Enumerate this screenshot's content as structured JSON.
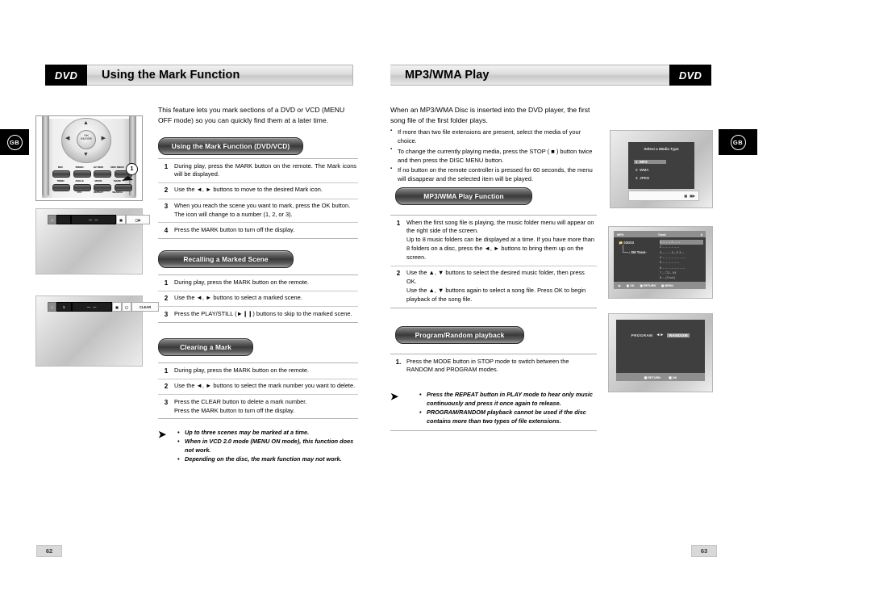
{
  "tabs": {
    "left_label": "GB",
    "right_label": "GB"
  },
  "left_page": {
    "badge": "DVD",
    "title": "Using the Mark Function",
    "intro": "This feature lets you mark sections of a DVD or VCD (MENU OFF mode) so you can quickly find them at a later time.",
    "page_number": "62",
    "sections": [
      {
        "heading": "Using the Mark Function (DVD/VCD)",
        "steps": [
          {
            "num": "1",
            "text": "During play, press the MARK button on the remote. The Mark icons will be displayed."
          },
          {
            "num": "2",
            "text": "Use the ◄, ► buttons to move to the desired Mark icon."
          },
          {
            "num": "3",
            "text": "When you reach the scene you want to mark, press the OK button. The icon will change to a number (1, 2, or 3)."
          },
          {
            "num": "4",
            "text": "Press the MARK button to turn off the display."
          }
        ]
      },
      {
        "heading": "Recalling a Marked Scene",
        "steps": [
          {
            "num": "1",
            "text": "During play, press the MARK button on the remote."
          },
          {
            "num": "2",
            "text": "Use the ◄, ► buttons to select a marked scene."
          },
          {
            "num": "3",
            "text": "Press the PLAY/STILL (►❙❙) buttons to skip to the marked scene."
          }
        ]
      },
      {
        "heading": "Clearing a Mark",
        "steps": [
          {
            "num": "1",
            "text": "During play, press the MARK button on the remote."
          },
          {
            "num": "2",
            "text": "Use the ◄, ► buttons to select the mark number you want to delete."
          },
          {
            "num": "3",
            "text": "Press the CLEAR button to delete a mark number.\nPress the MARK button to turn off the display."
          }
        ]
      }
    ],
    "notes": [
      "Up to three scenes may be marked at a time.",
      "When in VCD 2.0 mode (MENU ON mode), this function does not work.",
      "Depending on the disc, the mark function may not work."
    ],
    "remote": {
      "callout_number": "1",
      "center_label": "OK\nENTER",
      "buttons_row1": [
        "REC",
        "SPEED",
        "EZ VIEW",
        "DISC MENU"
      ],
      "buttons_row2": [
        "TIMER",
        "ANGLE",
        "MODE",
        "MARK"
      ],
      "buttons_row3_labels": [
        "",
        "VFC",
        "REPEAT",
        "SEARCH"
      ]
    },
    "osd_shots": [
      {
        "segments": [
          "①",
          "‒‒",
          "‒‒",
          "⬜⬜",
          "⏹"
        ],
        "mark_value": ""
      },
      {
        "segments": [
          "①",
          "1",
          "‒‒",
          "⬜",
          "CLEAR"
        ],
        "mark_value": "1",
        "clear_label": "CLEAR"
      }
    ]
  },
  "right_page": {
    "badge": "DVD",
    "title": "MP3/WMA Play",
    "intro": "When an MP3/WMA Disc is inserted into the DVD player, the first song file of the first folder plays.",
    "page_number": "63",
    "bullets": [
      "If more than two file extensions are present, select the media of your choice.",
      "To change the currently playing media, press the STOP ( ■ ) button twice and then press the DISC MENU button.",
      "If no button on the remote controller is pressed for 60 seconds, the menu will disappear and the selected item will be played."
    ],
    "sections": [
      {
        "heading": "MP3/WMA Play Function",
        "steps": [
          {
            "num": "1",
            "text": "When the first song file is playing, the music folder menu will appear on the right side of the screen.\nUp to 8 music folders can be displayed at a time. If you have more than 8 folders on a disc, press the ◄, ► buttons to bring them up on the screen."
          },
          {
            "num": "2",
            "text": "Use the ▲, ▼ buttons to select the desired music folder, then press OK.\nUse the ▲, ▼ buttons again to select a song file. Press OK to begin playback of the song file."
          }
        ]
      },
      {
        "heading": "Program/Random playback",
        "steps": [
          {
            "num": "1.",
            "text": "Press the MODE button in STOP mode to switch between the RANDOM and PROGRAM modes."
          }
        ]
      }
    ],
    "notes": [
      "Press the REPEAT button in PLAY mode to hear only music continuously and press it once again to release.",
      "PROGRAM/RANDOM playback cannot be used if the disc contains more than two types of file extensions."
    ],
    "screens": {
      "media_type": {
        "title": "Select a Media Type",
        "items": [
          {
            "num": "1",
            "label": "MP3",
            "selected": true
          },
          {
            "num": "2",
            "label": "WMA",
            "selected": false
          },
          {
            "num": "3",
            "label": "JPEG",
            "selected": false
          }
        ],
        "bottom_icons": [
          "OK",
          "STOP"
        ]
      },
      "music_folder": {
        "header_left": "MP3",
        "header_center": "Total:",
        "header_count": "8",
        "folder": "03G03",
        "file": "SM Town-",
        "tracks": [
          {
            "num": "1",
            "label": "‒ ‒ ‒ /‒ ‒ ‒",
            "selected": true
          },
          {
            "num": "2",
            "label": "‒ ‒ ‒ ‒ ‒ ‒",
            "selected": false
          },
          {
            "num": "3",
            "label": "‒ ‒ ‒ 2‒.0 3 ‒",
            "selected": false
          },
          {
            "num": "4",
            "label": "‒ ‒ ‒ ‒ ‒ ‒ ‒ ‒",
            "selected": false
          },
          {
            "num": "5",
            "label": "‒ ‒ ‒ ‒ ‒ ‒",
            "selected": false
          },
          {
            "num": "6",
            "label": "‒ ‒ ‒ ‒ ‒ ‒ ‒ ‒",
            "selected": false
          },
          {
            "num": "7",
            "label": "‒ □2‒ 04",
            "selected": false
          },
          {
            "num": "8",
            "label": "‒ (Cool)",
            "selected": false
          }
        ],
        "bottom_buttons": [
          "OK",
          "RETURN",
          "MENU"
        ]
      },
      "program_random": {
        "left_label": "PROGRAM",
        "arrows": "◄►",
        "right_label": "RANDOM",
        "right_selected": true,
        "bottom_buttons": [
          "RETURN",
          "OK"
        ]
      }
    }
  }
}
